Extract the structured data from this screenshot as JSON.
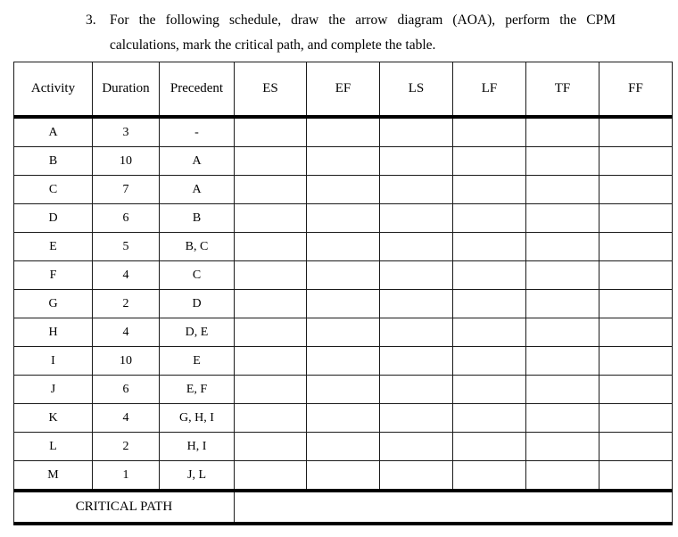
{
  "question": {
    "number": "3.",
    "line1": "For the following schedule, draw the arrow diagram (AOA), perform the CPM",
    "line2": "calculations, mark the critical path, and complete the table."
  },
  "table": {
    "headers": [
      "Activity",
      "Duration",
      "Precedent",
      "ES",
      "EF",
      "LS",
      "LF",
      "TF",
      "FF"
    ],
    "rows": [
      {
        "activity": "A",
        "duration": "3",
        "precedent": "-"
      },
      {
        "activity": "B",
        "duration": "10",
        "precedent": "A"
      },
      {
        "activity": "C",
        "duration": "7",
        "precedent": "A"
      },
      {
        "activity": "D",
        "duration": "6",
        "precedent": "B"
      },
      {
        "activity": "E",
        "duration": "5",
        "precedent": "B, C"
      },
      {
        "activity": "F",
        "duration": "4",
        "precedent": "C"
      },
      {
        "activity": "G",
        "duration": "2",
        "precedent": "D"
      },
      {
        "activity": "H",
        "duration": "4",
        "precedent": "D, E"
      },
      {
        "activity": "I",
        "duration": "10",
        "precedent": "E"
      },
      {
        "activity": "J",
        "duration": "6",
        "precedent": "E, F"
      },
      {
        "activity": "K",
        "duration": "4",
        "precedent": "G, H, I"
      },
      {
        "activity": "L",
        "duration": "2",
        "precedent": "H, I"
      },
      {
        "activity": "M",
        "duration": "1",
        "precedent": "J, L"
      }
    ],
    "critical_path_label": "CRITICAL PATH",
    "critical_path_value": ""
  }
}
